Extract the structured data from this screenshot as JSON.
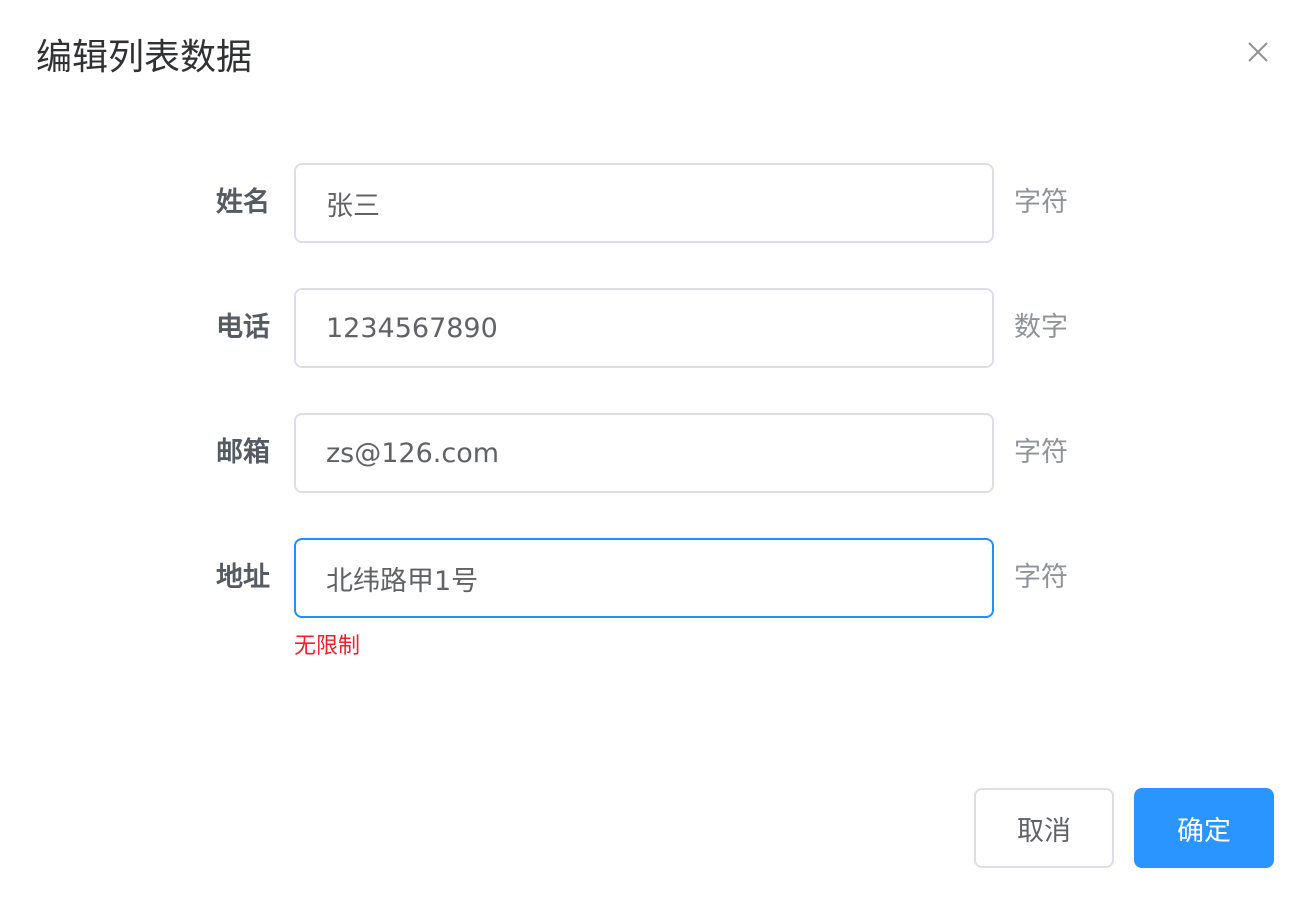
{
  "dialog": {
    "title": "编辑列表数据"
  },
  "form": {
    "fields": [
      {
        "label": "姓名",
        "value": "张三",
        "hint": "字符"
      },
      {
        "label": "电话",
        "value": "1234567890",
        "hint": "数字"
      },
      {
        "label": "邮箱",
        "value": "zs@126.com",
        "hint": "字符"
      },
      {
        "label": "地址",
        "value": "北纬路甲1号",
        "hint": "字符"
      }
    ],
    "address_message": "无限制"
  },
  "footer": {
    "cancel_label": "取消",
    "confirm_label": "确定"
  },
  "colors": {
    "primary": "#2b95ff",
    "focus_border": "#1e90ff",
    "error": "#f0212b"
  },
  "icons": {
    "close": "close-icon"
  }
}
